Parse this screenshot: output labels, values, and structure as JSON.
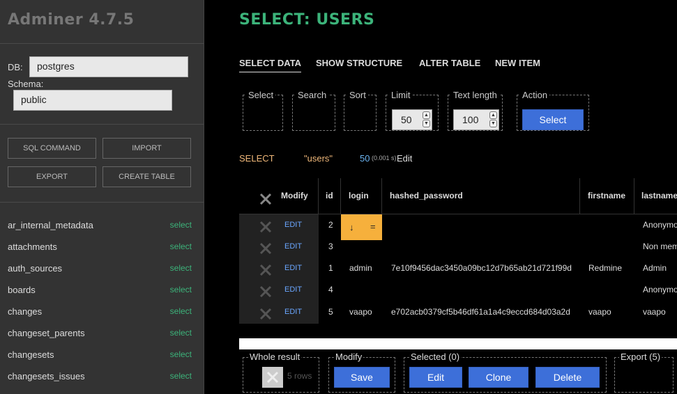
{
  "app": {
    "brand": "Adminer 4.7.5"
  },
  "sidebar": {
    "db_label": "DB:",
    "db_value": "postgres",
    "schema_label": "Schema:",
    "schema_value": "public",
    "buttons": [
      "SQL COMMAND",
      "IMPORT",
      "EXPORT",
      "CREATE TABLE"
    ],
    "select_label": "select",
    "tables": [
      "ar_internal_metadata",
      "attachments",
      "auth_sources",
      "boards",
      "changes",
      "changeset_parents",
      "changesets",
      "changesets_issues"
    ]
  },
  "main": {
    "title": "SELECT: USERS",
    "tabs": [
      "SELECT DATA",
      "SHOW STRUCTURE",
      "ALTER TABLE",
      "NEW ITEM"
    ],
    "controls": {
      "select_legend": "Select",
      "search_legend": "Search",
      "sort_legend": "Sort",
      "limit_legend": "Limit",
      "limit_value": "50",
      "textlength_legend": "Text length",
      "textlength_value": "100",
      "action_legend": "Action",
      "action_button": "Select"
    },
    "sql": {
      "keyword": "SELECT",
      "table": "\"users\"",
      "limit": "50",
      "time": "(0.001 s)",
      "edit": "Edit"
    },
    "table": {
      "columns": [
        "Modify",
        "id",
        "login",
        "hashed_password",
        "firstname",
        "lastname"
      ],
      "edit_label": "EDIT",
      "rows": [
        {
          "id": "2",
          "login": "",
          "hashed_password": "",
          "firstname": "",
          "lastname": "Anonymo"
        },
        {
          "id": "3",
          "login": "",
          "hashed_password": "",
          "firstname": "",
          "lastname": "Non mem"
        },
        {
          "id": "1",
          "login": "admin",
          "hashed_password": "7e10f9456dac3450a09bc12d7b65ab21d721f99d",
          "firstname": "Redmine",
          "lastname": "Admin"
        },
        {
          "id": "4",
          "login": "",
          "hashed_password": "",
          "firstname": "",
          "lastname": "Anonymo"
        },
        {
          "id": "5",
          "login": "vaapo",
          "hashed_password": "e702acb0379cf5b46df61a1a4c9eccd684d03a2d",
          "firstname": "vaapo",
          "lastname": "vaapo"
        }
      ],
      "sort_glyph": "↓",
      "eq_glyph": "="
    },
    "bottom": {
      "whole_result": "Whole result",
      "rows_count": "5 rows",
      "modify_legend": "Modify",
      "save": "Save",
      "selected_legend": "Selected (0)",
      "edit": "Edit",
      "clone": "Clone",
      "delete": "Delete",
      "export_legend": "Export (5)"
    }
  }
}
